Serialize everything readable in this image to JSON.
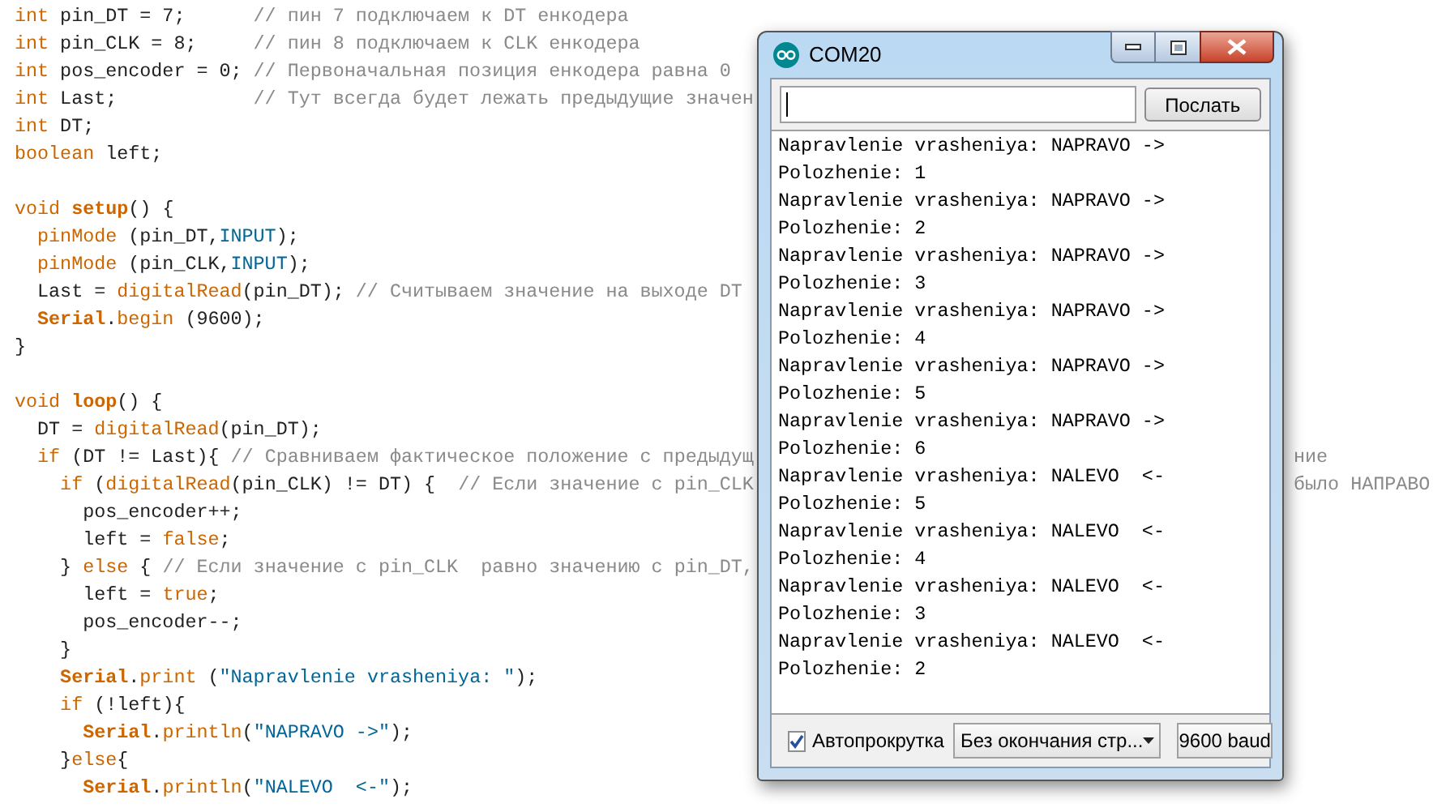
{
  "editor": {
    "blocks": [
      {
        "lines": [
          {
            "tokens": [
              {
                "kind": "type",
                "text": "int"
              },
              {
                "kind": "plain",
                "text": " pin_DT = 7;      "
              },
              {
                "kind": "comment",
                "text": "// пин 7 подключаем к DT енкодера"
              }
            ]
          },
          {
            "tokens": [
              {
                "kind": "type",
                "text": "int"
              },
              {
                "kind": "plain",
                "text": " pin_CLK = 8;     "
              },
              {
                "kind": "comment",
                "text": "// пин 8 подключаем к CLK енкодера"
              }
            ]
          },
          {
            "tokens": [
              {
                "kind": "type",
                "text": "int"
              },
              {
                "kind": "plain",
                "text": " pos_encoder = 0; "
              },
              {
                "kind": "comment",
                "text": "// Первоначальная позиция енкодера равна 0"
              }
            ]
          },
          {
            "tokens": [
              {
                "kind": "type",
                "text": "int"
              },
              {
                "kind": "plain",
                "text": " Last;            "
              },
              {
                "kind": "comment",
                "text": "// Тут всегда будет лежать предыдущие значен"
              }
            ]
          },
          {
            "tokens": [
              {
                "kind": "type",
                "text": "int"
              },
              {
                "kind": "plain",
                "text": " DT;"
              }
            ]
          },
          {
            "tokens": [
              {
                "kind": "type",
                "text": "boolean"
              },
              {
                "kind": "plain",
                "text": " left;"
              }
            ]
          }
        ]
      },
      {
        "lines": [
          {
            "tokens": [
              {
                "kind": "type",
                "text": "void "
              },
              {
                "kind": "bold",
                "text": "setup"
              },
              {
                "kind": "plain",
                "text": "() {"
              }
            ]
          },
          {
            "tokens": [
              {
                "kind": "func",
                "text": "  pinMode"
              },
              {
                "kind": "plain",
                "text": " (pin_DT,"
              },
              {
                "kind": "const",
                "text": "INPUT"
              },
              {
                "kind": "plain",
                "text": ");"
              }
            ]
          },
          {
            "tokens": [
              {
                "kind": "func",
                "text": "  pinMode"
              },
              {
                "kind": "plain",
                "text": " (pin_CLK,"
              },
              {
                "kind": "const",
                "text": "INPUT"
              },
              {
                "kind": "plain",
                "text": ");"
              }
            ]
          },
          {
            "tokens": [
              {
                "kind": "plain",
                "text": "  Last = "
              },
              {
                "kind": "func",
                "text": "digitalRead"
              },
              {
                "kind": "plain",
                "text": "(pin_DT); "
              },
              {
                "kind": "comment",
                "text": "// Считываем значение на выходе DT"
              }
            ]
          },
          {
            "tokens": [
              {
                "kind": "bold",
                "text": "  Serial"
              },
              {
                "kind": "plain",
                "text": "."
              },
              {
                "kind": "func",
                "text": "begin"
              },
              {
                "kind": "plain",
                "text": " (9600);"
              }
            ]
          },
          {
            "tokens": [
              {
                "kind": "plain",
                "text": "}"
              }
            ]
          }
        ]
      },
      {
        "lines": [
          {
            "tokens": [
              {
                "kind": "type",
                "text": "void "
              },
              {
                "kind": "bold",
                "text": "loop"
              },
              {
                "kind": "plain",
                "text": "() {"
              }
            ]
          },
          {
            "tokens": [
              {
                "kind": "plain",
                "text": "  DT = "
              },
              {
                "kind": "func",
                "text": "digitalRead"
              },
              {
                "kind": "plain",
                "text": "(pin_DT);"
              }
            ]
          },
          {
            "tokens": [
              {
                "kind": "type",
                "text": "  if"
              },
              {
                "kind": "plain",
                "text": " (DT != Last){ "
              },
              {
                "kind": "comment",
                "text": "// Сравниваем фактическое положение с предыдущ"
              }
            ],
            "right_fragment": "ние"
          },
          {
            "tokens": [
              {
                "kind": "type",
                "text": "    if"
              },
              {
                "kind": "plain",
                "text": " ("
              },
              {
                "kind": "func",
                "text": "digitalRead"
              },
              {
                "kind": "plain",
                "text": "(pin_CLK) != DT) {  "
              },
              {
                "kind": "comment",
                "text": "// Если значение с pin_CLK"
              }
            ],
            "right_fragment": "было НАПРАВО"
          },
          {
            "tokens": [
              {
                "kind": "plain",
                "text": "      pos_encoder++;"
              }
            ]
          },
          {
            "tokens": [
              {
                "kind": "plain",
                "text": "      left = "
              },
              {
                "kind": "type",
                "text": "false"
              },
              {
                "kind": "plain",
                "text": ";"
              }
            ]
          },
          {
            "tokens": [
              {
                "kind": "plain",
                "text": "    } "
              },
              {
                "kind": "type",
                "text": "else"
              },
              {
                "kind": "plain",
                "text": " { "
              },
              {
                "kind": "comment",
                "text": "// Если значение с pin_CLK  равно значению с pin_DT,"
              }
            ]
          },
          {
            "tokens": [
              {
                "kind": "plain",
                "text": "      left = "
              },
              {
                "kind": "type",
                "text": "true"
              },
              {
                "kind": "plain",
                "text": ";"
              }
            ]
          },
          {
            "tokens": [
              {
                "kind": "plain",
                "text": "      pos_encoder--;"
              }
            ]
          },
          {
            "tokens": [
              {
                "kind": "plain",
                "text": "    }"
              }
            ]
          },
          {
            "tokens": [
              {
                "kind": "bold",
                "text": "    Serial"
              },
              {
                "kind": "plain",
                "text": "."
              },
              {
                "kind": "func",
                "text": "print"
              },
              {
                "kind": "plain",
                "text": " ("
              },
              {
                "kind": "string",
                "text": "\"Napravlenie vrasheniya: \""
              },
              {
                "kind": "plain",
                "text": ");"
              }
            ]
          },
          {
            "tokens": [
              {
                "kind": "type",
                "text": "    if"
              },
              {
                "kind": "plain",
                "text": " (!left){"
              }
            ]
          },
          {
            "tokens": [
              {
                "kind": "bold",
                "text": "      Serial"
              },
              {
                "kind": "plain",
                "text": "."
              },
              {
                "kind": "func",
                "text": "println"
              },
              {
                "kind": "plain",
                "text": "("
              },
              {
                "kind": "string",
                "text": "\"NAPRAVO ->\""
              },
              {
                "kind": "plain",
                "text": ");"
              }
            ]
          },
          {
            "tokens": [
              {
                "kind": "plain",
                "text": "    }"
              },
              {
                "kind": "type",
                "text": "else"
              },
              {
                "kind": "plain",
                "text": "{"
              }
            ]
          },
          {
            "tokens": [
              {
                "kind": "bold",
                "text": "      Serial"
              },
              {
                "kind": "plain",
                "text": "."
              },
              {
                "kind": "func",
                "text": "println"
              },
              {
                "kind": "plain",
                "text": "("
              },
              {
                "kind": "string",
                "text": "\"NALEVO  <-\""
              },
              {
                "kind": "plain",
                "text": ");"
              }
            ]
          }
        ]
      }
    ]
  },
  "serial_monitor": {
    "title": "COM20",
    "send_button": "Послать",
    "output_lines": [
      "Napravlenie vrasheniya: NAPRAVO ->",
      "Polozhenie: 1",
      "Napravlenie vrasheniya: NAPRAVO ->",
      "Polozhenie: 2",
      "Napravlenie vrasheniya: NAPRAVO ->",
      "Polozhenie: 3",
      "Napravlenie vrasheniya: NAPRAVO ->",
      "Polozhenie: 4",
      "Napravlenie vrasheniya: NAPRAVO ->",
      "Polozhenie: 5",
      "Napravlenie vrasheniya: NAPRAVO ->",
      "Polozhenie: 6",
      "Napravlenie vrasheniya: NALEVO  <-",
      "Polozhenie: 5",
      "Napravlenie vrasheniya: NALEVO  <-",
      "Polozhenie: 4",
      "Napravlenie vrasheniya: NALEVO  <-",
      "Polozhenie: 3",
      "Napravlenie vrasheniya: NALEVO  <-",
      "Polozhenie: 2"
    ],
    "autoscroll": {
      "label": "Автопрокрутка",
      "checked": true
    },
    "line_ending": "Без окончания стр...",
    "baud": "9600 baud"
  }
}
